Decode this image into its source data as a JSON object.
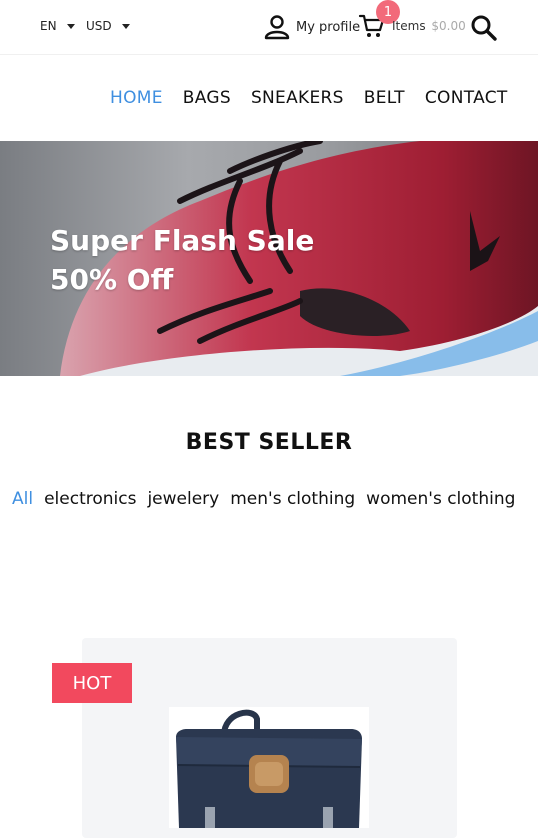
{
  "topbar": {
    "language": "EN",
    "currency": "USD",
    "profile_label": "My profile",
    "cart_count": "1",
    "items_label": "Items",
    "items_amount": "$0.00"
  },
  "nav": {
    "items": [
      "HOME",
      "BAGS",
      "SNEAKERS",
      "BELT",
      "CONTACT"
    ]
  },
  "banner": {
    "line1": "Super Flash Sale",
    "line2": "50% Off"
  },
  "section": {
    "title": "BEST SELLER",
    "filters": [
      "All",
      "electronics",
      "jewelery",
      "men's clothing",
      "women's clothing"
    ]
  },
  "product": {
    "badge": "HOT"
  },
  "colors": {
    "accent": "#3f8fe0",
    "badge": "#f26a7a",
    "hot": "#f2495e"
  }
}
